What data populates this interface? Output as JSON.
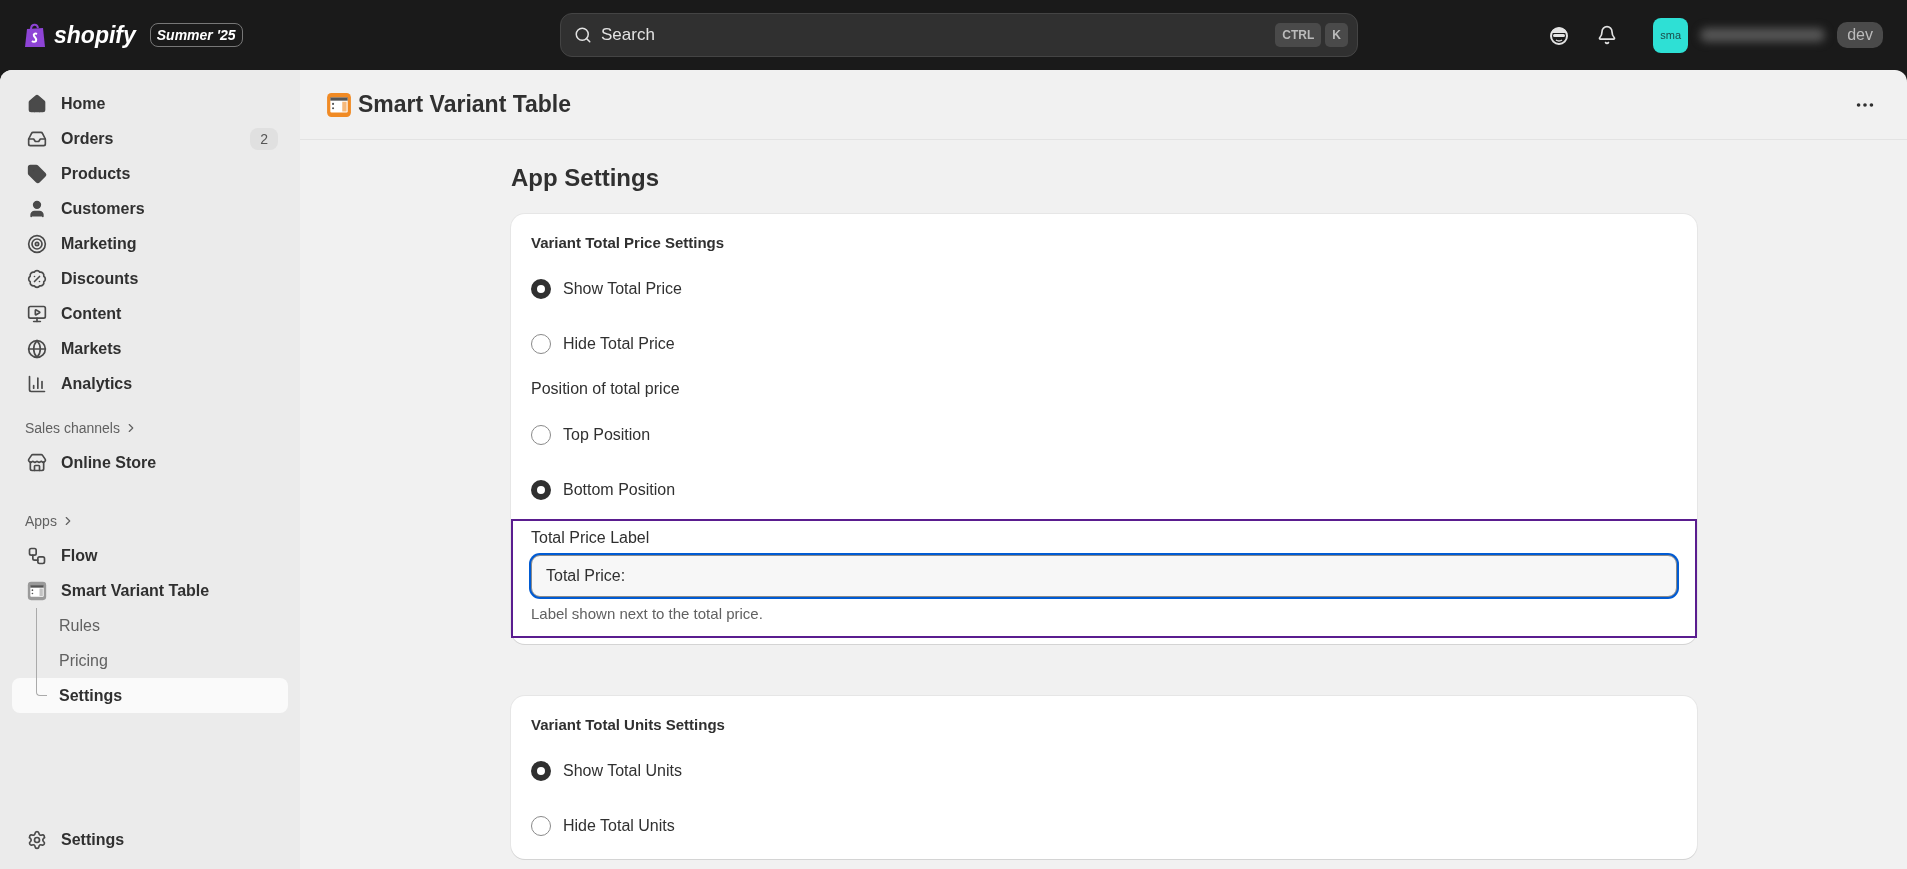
{
  "topbar": {
    "brand": "shopify",
    "edition": "Summer '25",
    "search": {
      "placeholder": "Search"
    },
    "shortcut": [
      "CTRL",
      "K"
    ],
    "avatar": "sma",
    "store_tag": "dev"
  },
  "sidebar": {
    "main": [
      {
        "kind": "home",
        "label": "Home"
      },
      {
        "kind": "orders",
        "label": "Orders",
        "badge": "2"
      },
      {
        "kind": "products",
        "label": "Products"
      },
      {
        "kind": "customers",
        "label": "Customers"
      },
      {
        "kind": "marketing",
        "label": "Marketing"
      },
      {
        "kind": "discounts",
        "label": "Discounts"
      },
      {
        "kind": "content",
        "label": "Content"
      },
      {
        "kind": "markets",
        "label": "Markets"
      },
      {
        "kind": "analytics",
        "label": "Analytics"
      }
    ],
    "sales_channels": {
      "title": "Sales channels",
      "items": [
        {
          "kind": "store",
          "label": "Online Store"
        }
      ]
    },
    "apps": {
      "title": "Apps",
      "items": [
        {
          "kind": "flow",
          "label": "Flow"
        },
        {
          "kind": "app",
          "label": "Smart Variant Table",
          "children": [
            {
              "label": "Rules",
              "selected": false
            },
            {
              "label": "Pricing",
              "selected": false
            },
            {
              "label": "Settings",
              "selected": true
            }
          ]
        }
      ]
    },
    "footer": {
      "kind": "settings",
      "label": "Settings"
    }
  },
  "page": {
    "title": "Smart Variant Table",
    "heading": "App Settings",
    "cards": [
      {
        "title": "Variant Total Price Settings",
        "fields": [
          {
            "kind": "radio",
            "label": "Show Total Price",
            "selected": true
          },
          {
            "kind": "radio",
            "label": "Hide Total Price",
            "selected": false
          },
          {
            "kind": "label",
            "text": "Position of total price"
          },
          {
            "kind": "radio",
            "label": "Top Position",
            "selected": false
          },
          {
            "kind": "radio",
            "label": "Bottom Position",
            "selected": true
          },
          {
            "kind": "text_input",
            "label": "Total Price Label",
            "value": "Total Price:",
            "help": "Label shown next to the total price.",
            "highlighted": true,
            "focused": true
          }
        ]
      },
      {
        "title": "Variant Total Units Settings",
        "fields": [
          {
            "kind": "radio",
            "label": "Show Total Units",
            "selected": true
          },
          {
            "kind": "radio",
            "label": "Hide Total Units",
            "selected": false
          }
        ]
      }
    ]
  }
}
